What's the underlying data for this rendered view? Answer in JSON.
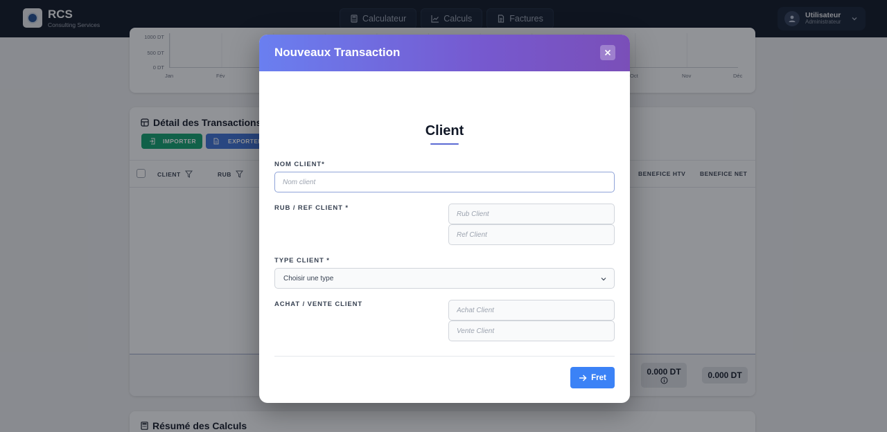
{
  "brand": {
    "name": "RCS",
    "subtitle": "Consulting Services"
  },
  "nav": [
    {
      "label": "Calculateur",
      "icon": "calculator-icon"
    },
    {
      "label": "Calculs",
      "icon": "chart-line-icon"
    },
    {
      "label": "Factures",
      "icon": "document-icon"
    }
  ],
  "user": {
    "name": "Utilisateur",
    "role": "Administrateur"
  },
  "chart": {
    "y_ticks": [
      "1000 DT",
      "500 DT",
      "0 DT"
    ],
    "x_ticks": [
      "Jan",
      "Fév",
      "Oct",
      "Nov",
      "Déc"
    ]
  },
  "transactions": {
    "title": "Détail des Transactions",
    "import_label": "IMPORTER",
    "export_label": "EXPORTER",
    "columns": [
      "CLIENT",
      "RUB",
      "BENEFICE HTV",
      "BENEFICE NET"
    ],
    "totals": [
      "0.000 DT",
      "0.000 DT"
    ]
  },
  "summary": {
    "title": "Résumé des Calculs"
  },
  "modal": {
    "title": "Nouveaux Transaction",
    "section": "Client",
    "nom_label": "NOM CLIENT*",
    "nom_placeholder": "Nom client",
    "rub_ref_label": "RUB / REF CLIENT *",
    "rub_placeholder": "Rub Client",
    "ref_placeholder": "Ref Client",
    "type_label": "TYPE CLIENT *",
    "type_value": "Choisir une type",
    "achat_vente_label": "ACHAT / VENTE CLIENT",
    "achat_placeholder": "Achat Client",
    "vente_placeholder": "Vente Client",
    "next_label": "Fret"
  },
  "colors": {
    "topbar": "#0b1424",
    "modal_header_start": "#6a7ff0",
    "modal_header_end": "#7a4fb8",
    "primary_button": "#3b82f6",
    "import_button": "#0f9f6e",
    "export_button": "#3b6fd3"
  }
}
